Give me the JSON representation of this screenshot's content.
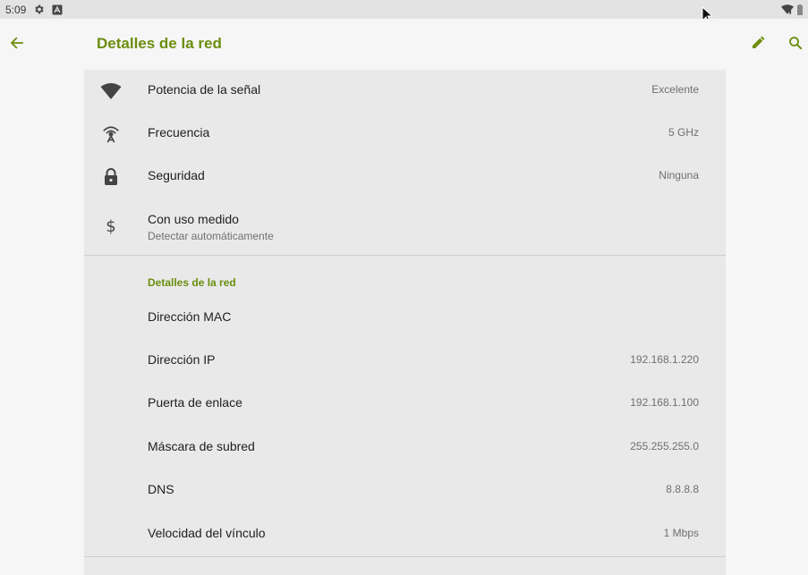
{
  "status_bar": {
    "time": "5:09",
    "icons": [
      "settings-icon",
      "notification-a-icon"
    ],
    "right_icons": [
      "wifi-status-icon",
      "battery-icon"
    ]
  },
  "toolbar": {
    "title": "Detalles de la red",
    "back_icon": "arrow-back-icon",
    "edit_icon": "pencil-icon",
    "search_icon": "search-icon"
  },
  "top_items": [
    {
      "label": "Potencia de la señal",
      "value": "Excelente",
      "icon": "wifi-signal-icon"
    },
    {
      "label": "Frecuencia",
      "value": "5 GHz",
      "icon": "antenna-icon"
    },
    {
      "label": "Seguridad",
      "value": "Ninguna",
      "icon": "lock-icon"
    },
    {
      "label": "Con uso medido",
      "sublabel": "Detectar automáticamente",
      "icon": "dollar-icon"
    }
  ],
  "details_section": {
    "header": "Detalles de la red",
    "items": [
      {
        "label": "Dirección MAC",
        "value": ""
      },
      {
        "label": "Dirección IP",
        "value": "192.168.1.220"
      },
      {
        "label": "Puerta de enlace",
        "value": "192.168.1.100"
      },
      {
        "label": "Máscara de subred",
        "value": "255.255.255.0"
      },
      {
        "label": "DNS",
        "value": "8.8.8.8"
      },
      {
        "label": "Velocidad del vínculo",
        "value": "1 Mbps"
      }
    ]
  },
  "colors": {
    "accent": "#6b8e0e",
    "panel": "#e9e9e9",
    "background": "#f6f6f6",
    "status_bar": "#e3e3e3"
  }
}
